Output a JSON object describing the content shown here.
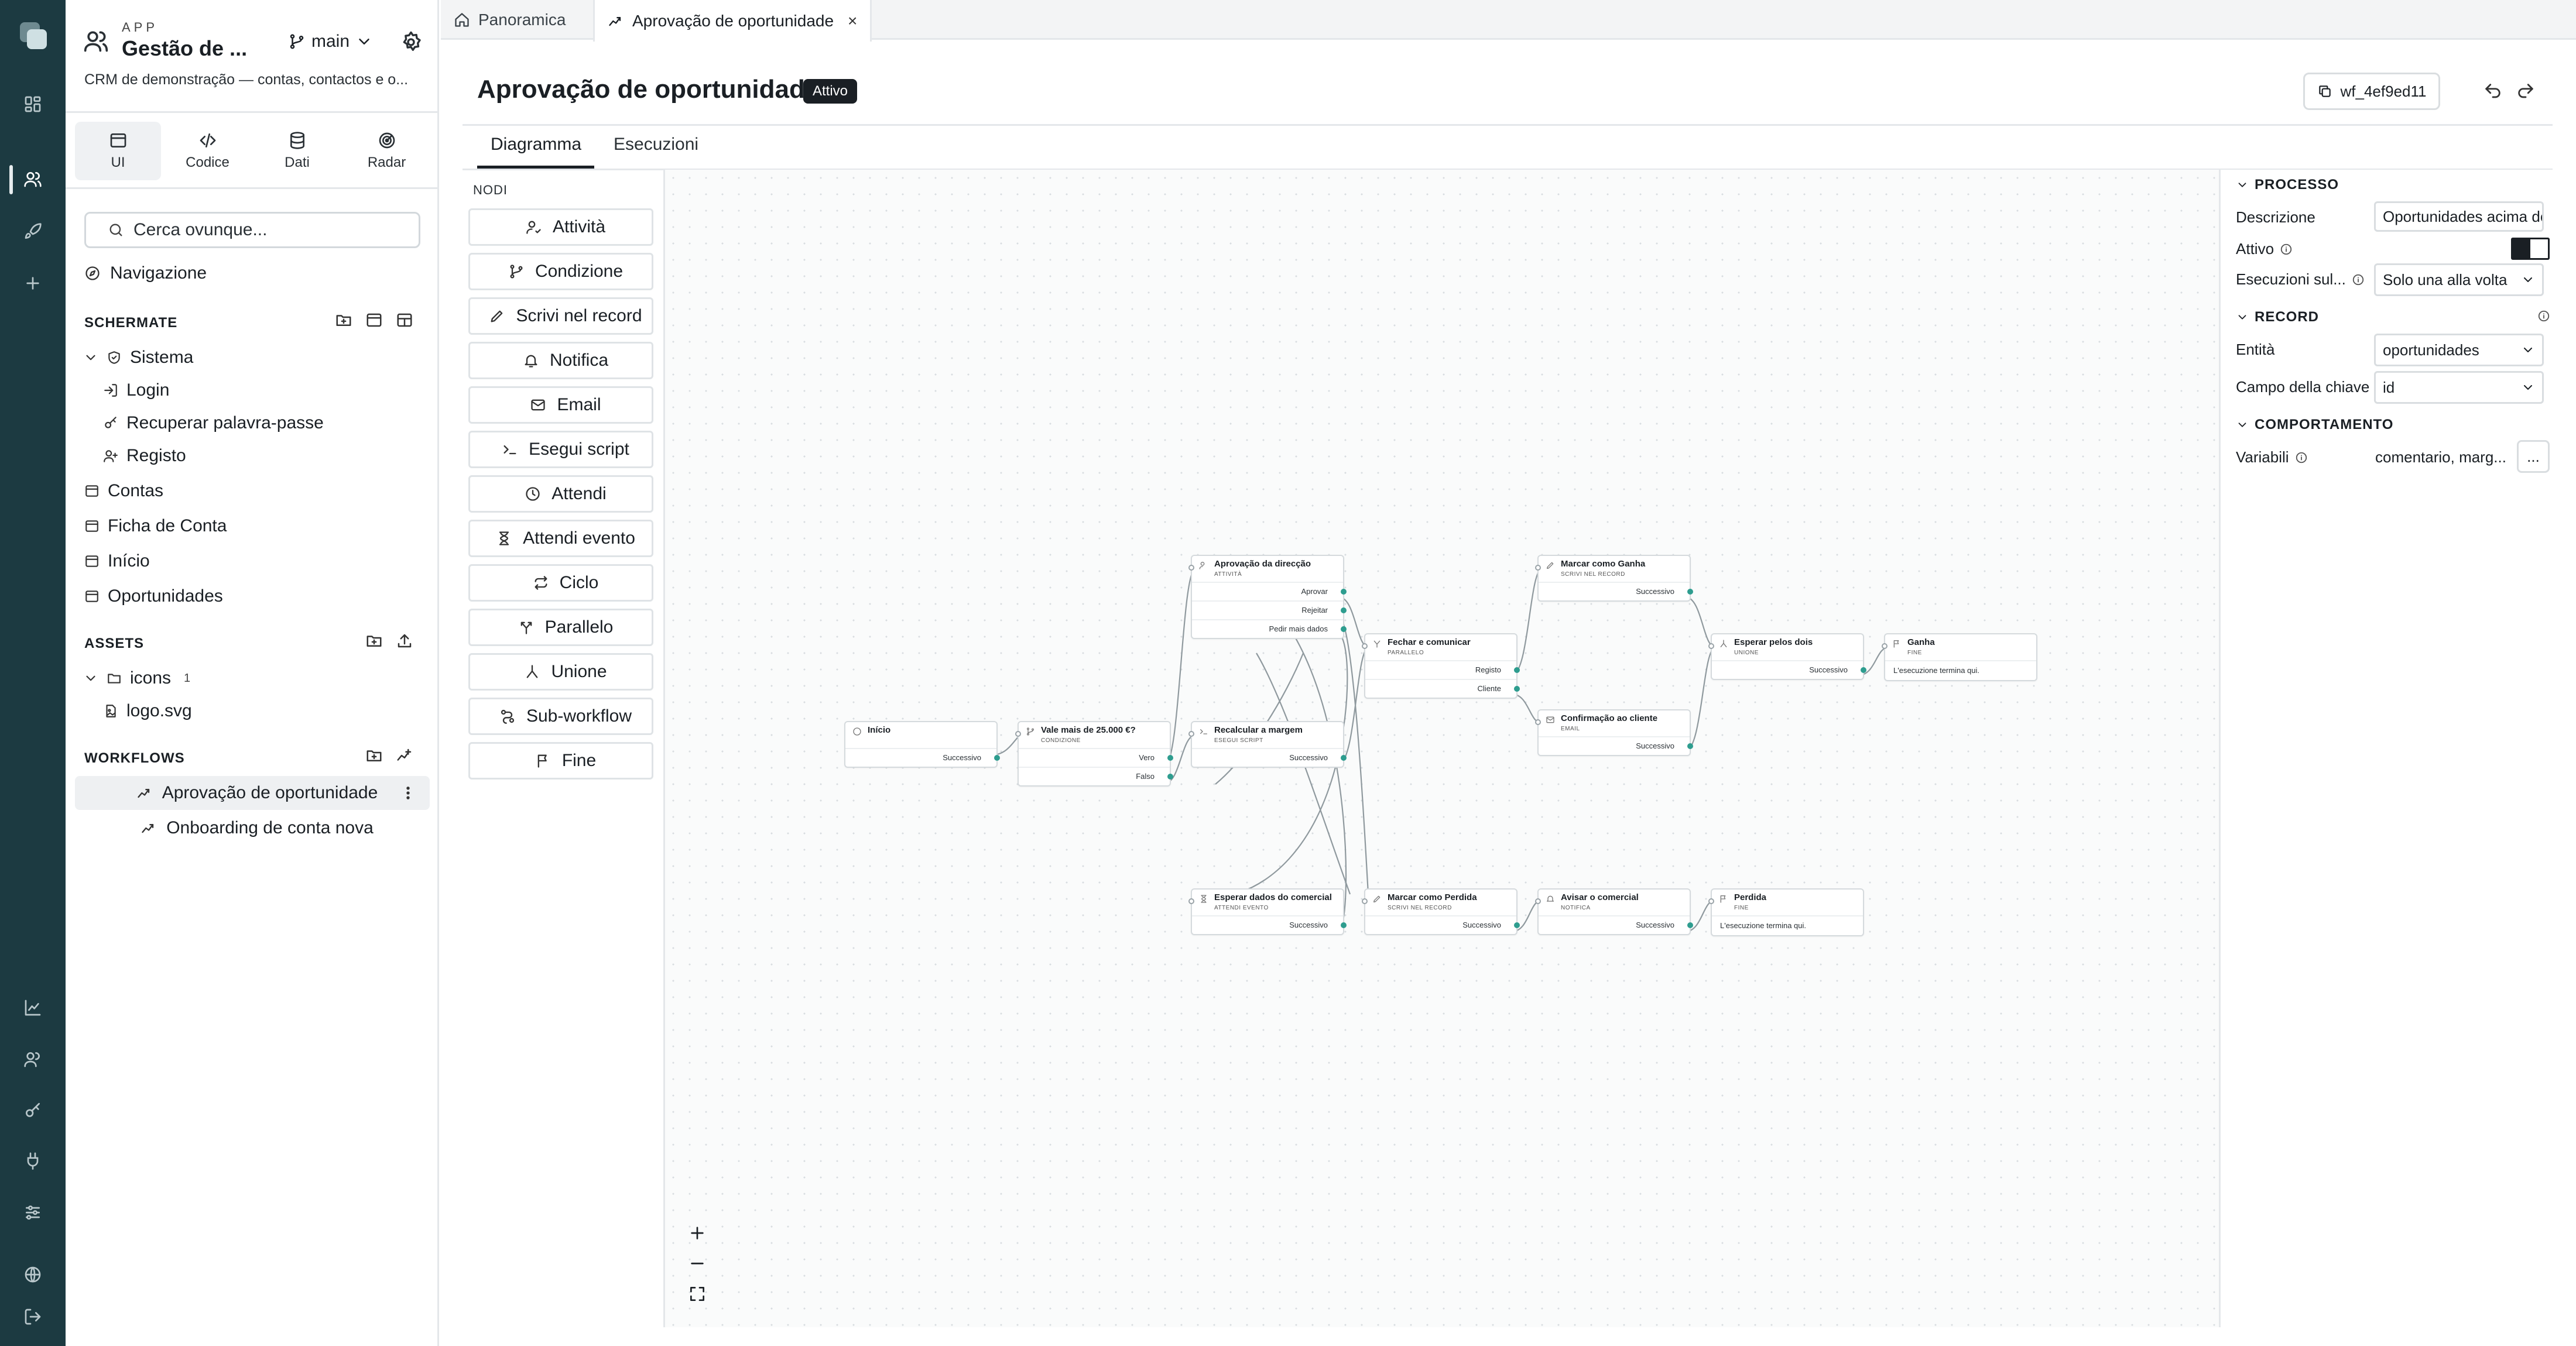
{
  "app": {
    "eyebrow": "APP",
    "name": "Gestão de ...",
    "branch": "main",
    "description": "CRM de demonstração — contas, contactos e o..."
  },
  "modes": [
    {
      "label": "UI",
      "icon": "window-icon"
    },
    {
      "label": "Codice",
      "icon": "code-icon"
    },
    {
      "label": "Dati",
      "icon": "database-icon"
    },
    {
      "label": "Radar",
      "icon": "radar-icon"
    }
  ],
  "search": {
    "placeholder": "Cerca ovunque..."
  },
  "navigation_label": "Navigazione",
  "screens": {
    "title": "SCHERMATE",
    "folder": "Sistema",
    "children": [
      "Login",
      "Recuperar palavra-passe",
      "Registo"
    ],
    "items": [
      "Contas",
      "Ficha de Conta",
      "Início",
      "Oportunidades"
    ]
  },
  "assets": {
    "title": "ASSETS",
    "folder": "icons",
    "folder_count": "1",
    "file": "logo.svg"
  },
  "workflows": {
    "title": "WORKFLOWS",
    "items": [
      "Aprovação de oportunidade",
      "Onboarding de conta nova"
    ]
  },
  "tabs": [
    {
      "label": "Panoramica"
    },
    {
      "label": "Aprovação de oportunidade"
    }
  ],
  "tab_close": "×",
  "page": {
    "title": "Aprovação de oportunidade",
    "status": "Attivo",
    "id": "wf_4ef9ed11"
  },
  "subtabs": [
    "Diagramma",
    "Esecuzioni"
  ],
  "palette": {
    "title": "NODI",
    "items": [
      "Attività",
      "Condizione",
      "Scrivi nel record",
      "Notifica",
      "Email",
      "Esegui script",
      "Attendi",
      "Attendi evento",
      "Ciclo",
      "Parallelo",
      "Unione",
      "Sub-workflow",
      "Fine"
    ]
  },
  "nodes": {
    "inizio": {
      "title": "Início",
      "rows": [
        "Successivo"
      ]
    },
    "vale": {
      "title": "Vale mais de 25.000 €?",
      "type": "CONDIZIONE",
      "rows": [
        "Vero",
        "Falso"
      ]
    },
    "aprov": {
      "title": "Aprovação da direcção",
      "type": "ATTIVITÀ",
      "rows": [
        "Aprovar",
        "Rejeitar",
        "Pedir mais dados"
      ]
    },
    "recalc": {
      "title": "Recalcular a margem",
      "type": "ESEGUI SCRIPT",
      "rows": [
        "Successivo"
      ]
    },
    "esperar": {
      "title": "Esperar dados do comercial",
      "type": "ATTENDI EVENTO",
      "rows": [
        "Successivo"
      ]
    },
    "fechar": {
      "title": "Fechar e comunicar",
      "type": "PARALLELO",
      "rows": [
        "Registo",
        "Cliente"
      ]
    },
    "marcarPerdida": {
      "title": "Marcar como Perdida",
      "type": "SCRIVI NEL RECORD",
      "rows": [
        "Successivo"
      ]
    },
    "marcarGanha": {
      "title": "Marcar como Ganha",
      "type": "SCRIVI NEL RECORD",
      "rows": [
        "Successivo"
      ]
    },
    "confirm": {
      "title": "Confirmação ao cliente",
      "type": "EMAIL",
      "rows": [
        "Successivo"
      ]
    },
    "avisar": {
      "title": "Avisar o comercial",
      "type": "NOTIFICA",
      "rows": [
        "Successivo"
      ]
    },
    "esperarDois": {
      "title": "Esperar pelos dois",
      "type": "UNIONE",
      "rows": [
        "Successivo"
      ]
    },
    "ganha": {
      "title": "Ganha",
      "type": "FINE",
      "foot": "L'esecuzione termina qui."
    },
    "perdida": {
      "title": "Perdida",
      "type": "FINE",
      "foot": "L'esecuzione termina qui."
    }
  },
  "zoom": {
    "in": "zoom-in-icon",
    "out": "zoom-out-icon",
    "fit": "fit-view-icon"
  },
  "props": {
    "processo": {
      "title": "PROCESSO",
      "descrizione_label": "Descrizione",
      "descrizione_value": "Oportunidades acima de",
      "attivo_label": "Attivo",
      "esecuzioni_label": "Esecuzioni sul...",
      "esecuzioni_value": "Solo una alla volta"
    },
    "record": {
      "title": "RECORD",
      "entita_label": "Entità",
      "entita_value": "oportunidades",
      "campo_label": "Campo della chiave",
      "campo_value": "id"
    },
    "comportamento": {
      "title": "COMPORTAMENTO",
      "variabili_label": "Variabili",
      "variabili_value": "comentario, marg...",
      "more": "..."
    }
  },
  "colors": {
    "rail": "#1c3a41",
    "port": "#2e9d8f",
    "edge": "#8f999e"
  }
}
